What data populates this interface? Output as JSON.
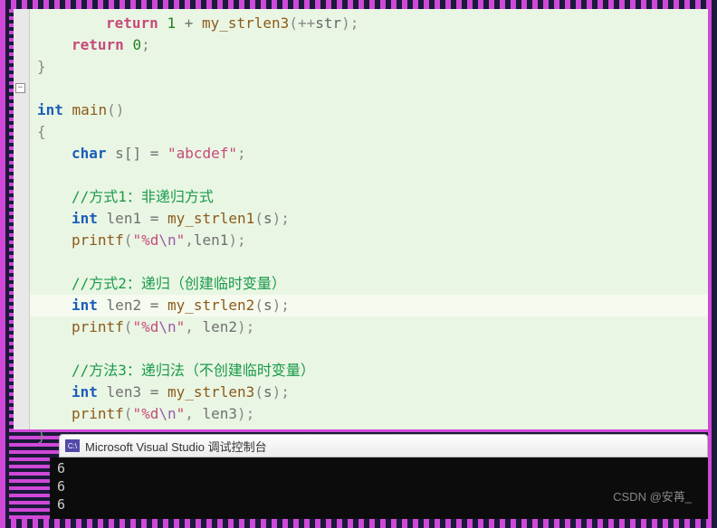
{
  "code_lines": [
    {
      "cls": "indent2",
      "tokens": [
        {
          "t": "return",
          "c": "kw-return"
        },
        {
          "t": " ",
          "c": ""
        },
        {
          "t": "1",
          "c": "num"
        },
        {
          "t": " + ",
          "c": "op"
        },
        {
          "t": "my_strlen3",
          "c": "func"
        },
        {
          "t": "(++",
          "c": "brace"
        },
        {
          "t": "str",
          "c": "param"
        },
        {
          "t": ");",
          "c": "brace"
        }
      ]
    },
    {
      "cls": "indent1",
      "tokens": [
        {
          "t": "return",
          "c": "kw-return"
        },
        {
          "t": " ",
          "c": ""
        },
        {
          "t": "0",
          "c": "num"
        },
        {
          "t": ";",
          "c": "brace"
        }
      ]
    },
    {
      "cls": "",
      "tokens": [
        {
          "t": "}",
          "c": "brace"
        }
      ]
    },
    {
      "cls": "",
      "tokens": [
        {
          "t": "",
          "c": ""
        }
      ],
      "fold": true
    },
    {
      "cls": "",
      "tokens": [
        {
          "t": "int",
          "c": "type"
        },
        {
          "t": " ",
          "c": ""
        },
        {
          "t": "main",
          "c": "func"
        },
        {
          "t": "()",
          "c": "brace"
        }
      ]
    },
    {
      "cls": "",
      "tokens": [
        {
          "t": "{",
          "c": "brace"
        }
      ]
    },
    {
      "cls": "indent1",
      "tokens": [
        {
          "t": "char",
          "c": "type"
        },
        {
          "t": " ",
          "c": ""
        },
        {
          "t": "s",
          "c": "ident"
        },
        {
          "t": "[] = ",
          "c": "op"
        },
        {
          "t": "\"abcdef\"",
          "c": "string"
        },
        {
          "t": ";",
          "c": "brace"
        }
      ]
    },
    {
      "cls": "indent1",
      "tokens": [
        {
          "t": "",
          "c": ""
        }
      ]
    },
    {
      "cls": "indent1",
      "tokens": [
        {
          "t": "//方式1：非递归方式",
          "c": "comment"
        }
      ]
    },
    {
      "cls": "indent1",
      "tokens": [
        {
          "t": "int",
          "c": "type"
        },
        {
          "t": " ",
          "c": ""
        },
        {
          "t": "len1",
          "c": "ident"
        },
        {
          "t": " = ",
          "c": "op"
        },
        {
          "t": "my_strlen1",
          "c": "func"
        },
        {
          "t": "(",
          "c": "brace"
        },
        {
          "t": "s",
          "c": "param"
        },
        {
          "t": ");",
          "c": "brace"
        }
      ]
    },
    {
      "cls": "indent1",
      "tokens": [
        {
          "t": "printf",
          "c": "func"
        },
        {
          "t": "(",
          "c": "brace"
        },
        {
          "t": "\"%d",
          "c": "string"
        },
        {
          "t": "\\n",
          "c": "escape"
        },
        {
          "t": "\"",
          "c": "string"
        },
        {
          "t": ",",
          "c": "brace"
        },
        {
          "t": "len1",
          "c": "ident"
        },
        {
          "t": ");",
          "c": "brace"
        }
      ]
    },
    {
      "cls": "indent1",
      "tokens": [
        {
          "t": "",
          "c": ""
        }
      ]
    },
    {
      "cls": "indent1",
      "tokens": [
        {
          "t": "//方式2：递归（创建临时变量）",
          "c": "comment"
        }
      ]
    },
    {
      "cls": "indent1 hl",
      "tokens": [
        {
          "t": "int",
          "c": "type"
        },
        {
          "t": " ",
          "c": ""
        },
        {
          "t": "len2",
          "c": "ident"
        },
        {
          "t": " = ",
          "c": "op"
        },
        {
          "t": "my_strlen2",
          "c": "func"
        },
        {
          "t": "(",
          "c": "brace"
        },
        {
          "t": "s",
          "c": "param"
        },
        {
          "t": ");",
          "c": "brace"
        }
      ]
    },
    {
      "cls": "indent1",
      "tokens": [
        {
          "t": "printf",
          "c": "func"
        },
        {
          "t": "(",
          "c": "brace"
        },
        {
          "t": "\"%d",
          "c": "string"
        },
        {
          "t": "\\n",
          "c": "escape"
        },
        {
          "t": "\"",
          "c": "string"
        },
        {
          "t": ", ",
          "c": "brace"
        },
        {
          "t": "len2",
          "c": "ident"
        },
        {
          "t": ");",
          "c": "brace"
        }
      ]
    },
    {
      "cls": "indent1",
      "tokens": [
        {
          "t": "",
          "c": ""
        }
      ]
    },
    {
      "cls": "indent1",
      "tokens": [
        {
          "t": "//方法3：递归法（不创建临时变量）",
          "c": "comment"
        }
      ]
    },
    {
      "cls": "indent1",
      "tokens": [
        {
          "t": "int",
          "c": "type"
        },
        {
          "t": " ",
          "c": ""
        },
        {
          "t": "len3",
          "c": "ident"
        },
        {
          "t": " = ",
          "c": "op"
        },
        {
          "t": "my_strlen3",
          "c": "func"
        },
        {
          "t": "(",
          "c": "brace"
        },
        {
          "t": "s",
          "c": "param"
        },
        {
          "t": ");",
          "c": "brace"
        }
      ]
    },
    {
      "cls": "indent1",
      "tokens": [
        {
          "t": "printf",
          "c": "func"
        },
        {
          "t": "(",
          "c": "brace"
        },
        {
          "t": "\"%d",
          "c": "string"
        },
        {
          "t": "\\n",
          "c": "escape"
        },
        {
          "t": "\"",
          "c": "string"
        },
        {
          "t": ", ",
          "c": "brace"
        },
        {
          "t": "len3",
          "c": "ident"
        },
        {
          "t": ");",
          "c": "brace"
        }
      ]
    },
    {
      "cls": "",
      "tokens": [
        {
          "t": "}",
          "c": "brace"
        }
      ]
    }
  ],
  "console": {
    "icon_text": "C:\\",
    "title": "Microsoft Visual Studio 调试控制台",
    "output": [
      "6",
      "6",
      "6"
    ]
  },
  "watermark": "CSDN @安苒_"
}
